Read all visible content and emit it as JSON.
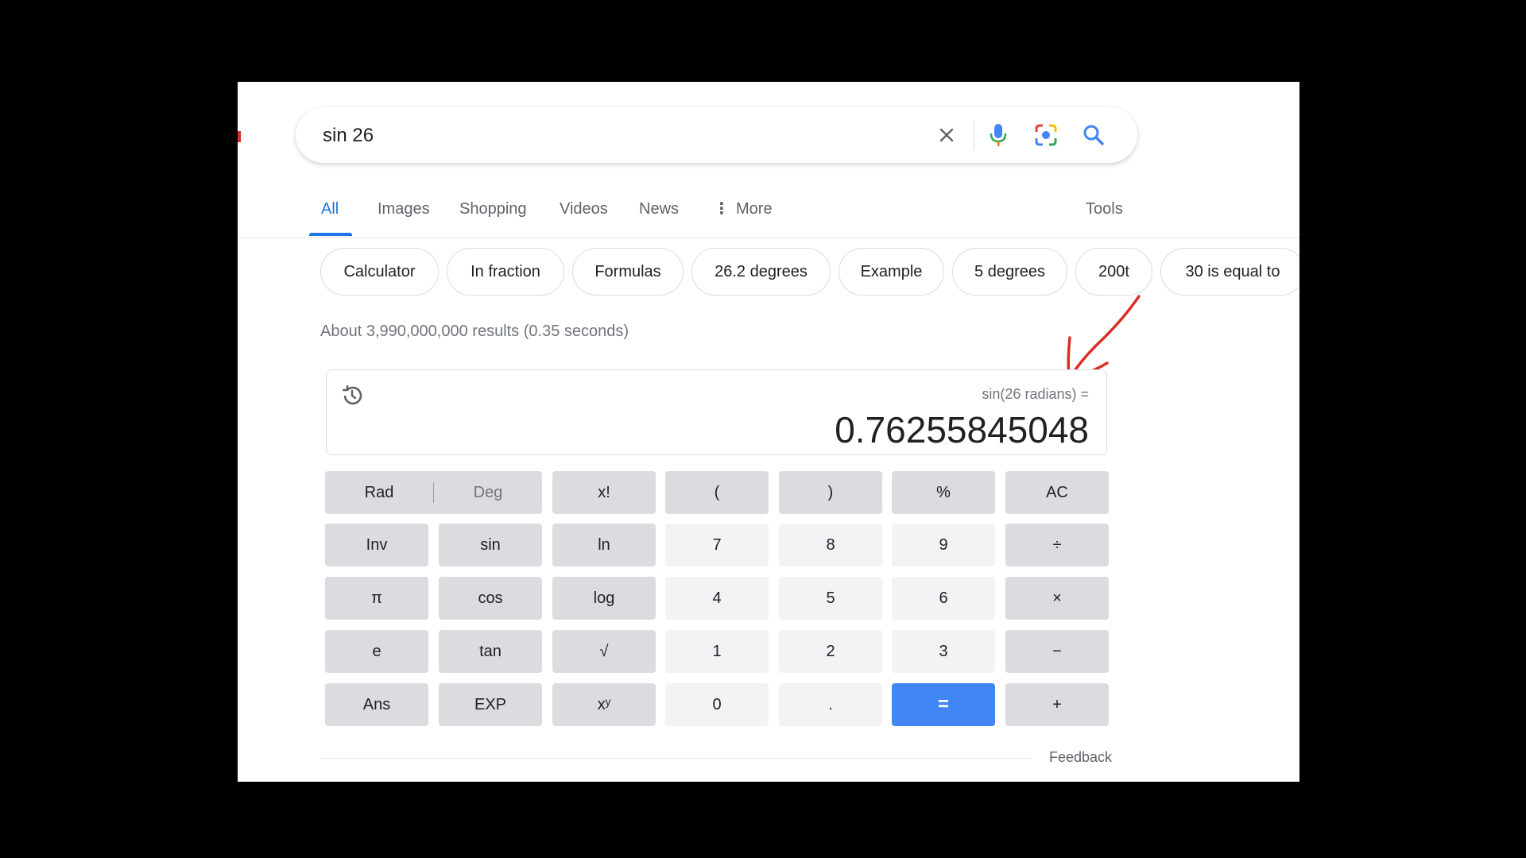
{
  "search": {
    "query": "sin 26"
  },
  "tabs": [
    {
      "label": "All",
      "active": true
    },
    {
      "label": "Images"
    },
    {
      "label": "Shopping"
    },
    {
      "label": "Videos"
    },
    {
      "label": "News"
    },
    {
      "label": "More"
    }
  ],
  "tools_label": "Tools",
  "chips": [
    "Calculator",
    "In fraction",
    "Formulas",
    "26.2 degrees",
    "Example",
    "5 degrees",
    "200t",
    "30 is equal to"
  ],
  "results_count": "About 3,990,000,000 results (0.35 seconds)",
  "calculator": {
    "expression": "sin(26 radians) =",
    "result": "0.76255845048",
    "mode": {
      "rad": "Rad",
      "deg": "Deg"
    },
    "keys": {
      "fact": "x!",
      "lparen": "(",
      "rparen": ")",
      "percent": "%",
      "ac": "AC",
      "inv": "Inv",
      "sin": "sin",
      "ln": "ln",
      "seven": "7",
      "eight": "8",
      "nine": "9",
      "divide": "÷",
      "pi": "π",
      "cos": "cos",
      "log": "log",
      "four": "4",
      "five": "5",
      "six": "6",
      "multiply": "×",
      "e": "e",
      "tan": "tan",
      "sqrt": "√",
      "one": "1",
      "two": "2",
      "three": "3",
      "minus": "−",
      "ans": "Ans",
      "exp": "EXP",
      "pow": "xʸ",
      "zero": "0",
      "dot": ".",
      "equals": "=",
      "plus": "+"
    }
  },
  "feedback": "Feedback",
  "colors": {
    "accent": "#1a73e8",
    "equals_key": "#4285f4",
    "annotation": "#d93025"
  }
}
